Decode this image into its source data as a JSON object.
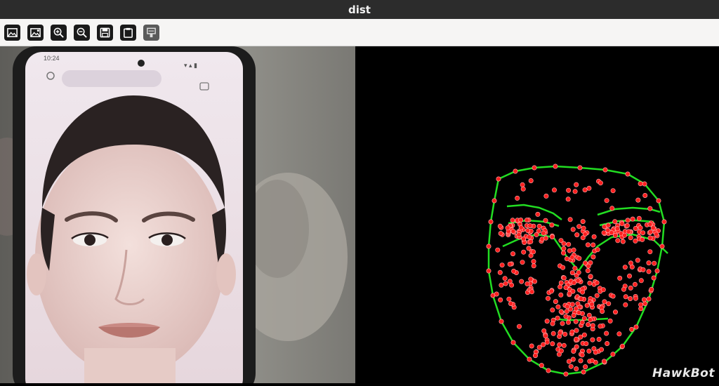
{
  "window": {
    "title": "dist"
  },
  "toolbar": {
    "buttons": [
      {
        "name": "pan",
        "icon": "image-icon"
      },
      {
        "name": "zoom-rect",
        "icon": "image-zoom-icon"
      },
      {
        "name": "zoom-in",
        "icon": "zoom-in-icon"
      },
      {
        "name": "zoom-out",
        "icon": "zoom-out-icon"
      },
      {
        "name": "save",
        "icon": "save-icon"
      },
      {
        "name": "copy",
        "icon": "clipboard-icon"
      },
      {
        "name": "properties",
        "icon": "properties-icon",
        "enabled": false
      }
    ]
  },
  "views": {
    "camera": {
      "description_icon": "camera-view"
    },
    "landmarks": {
      "point_color": "#ff2020",
      "line_color": "#22dd22"
    }
  },
  "watermark": "HawkBot"
}
